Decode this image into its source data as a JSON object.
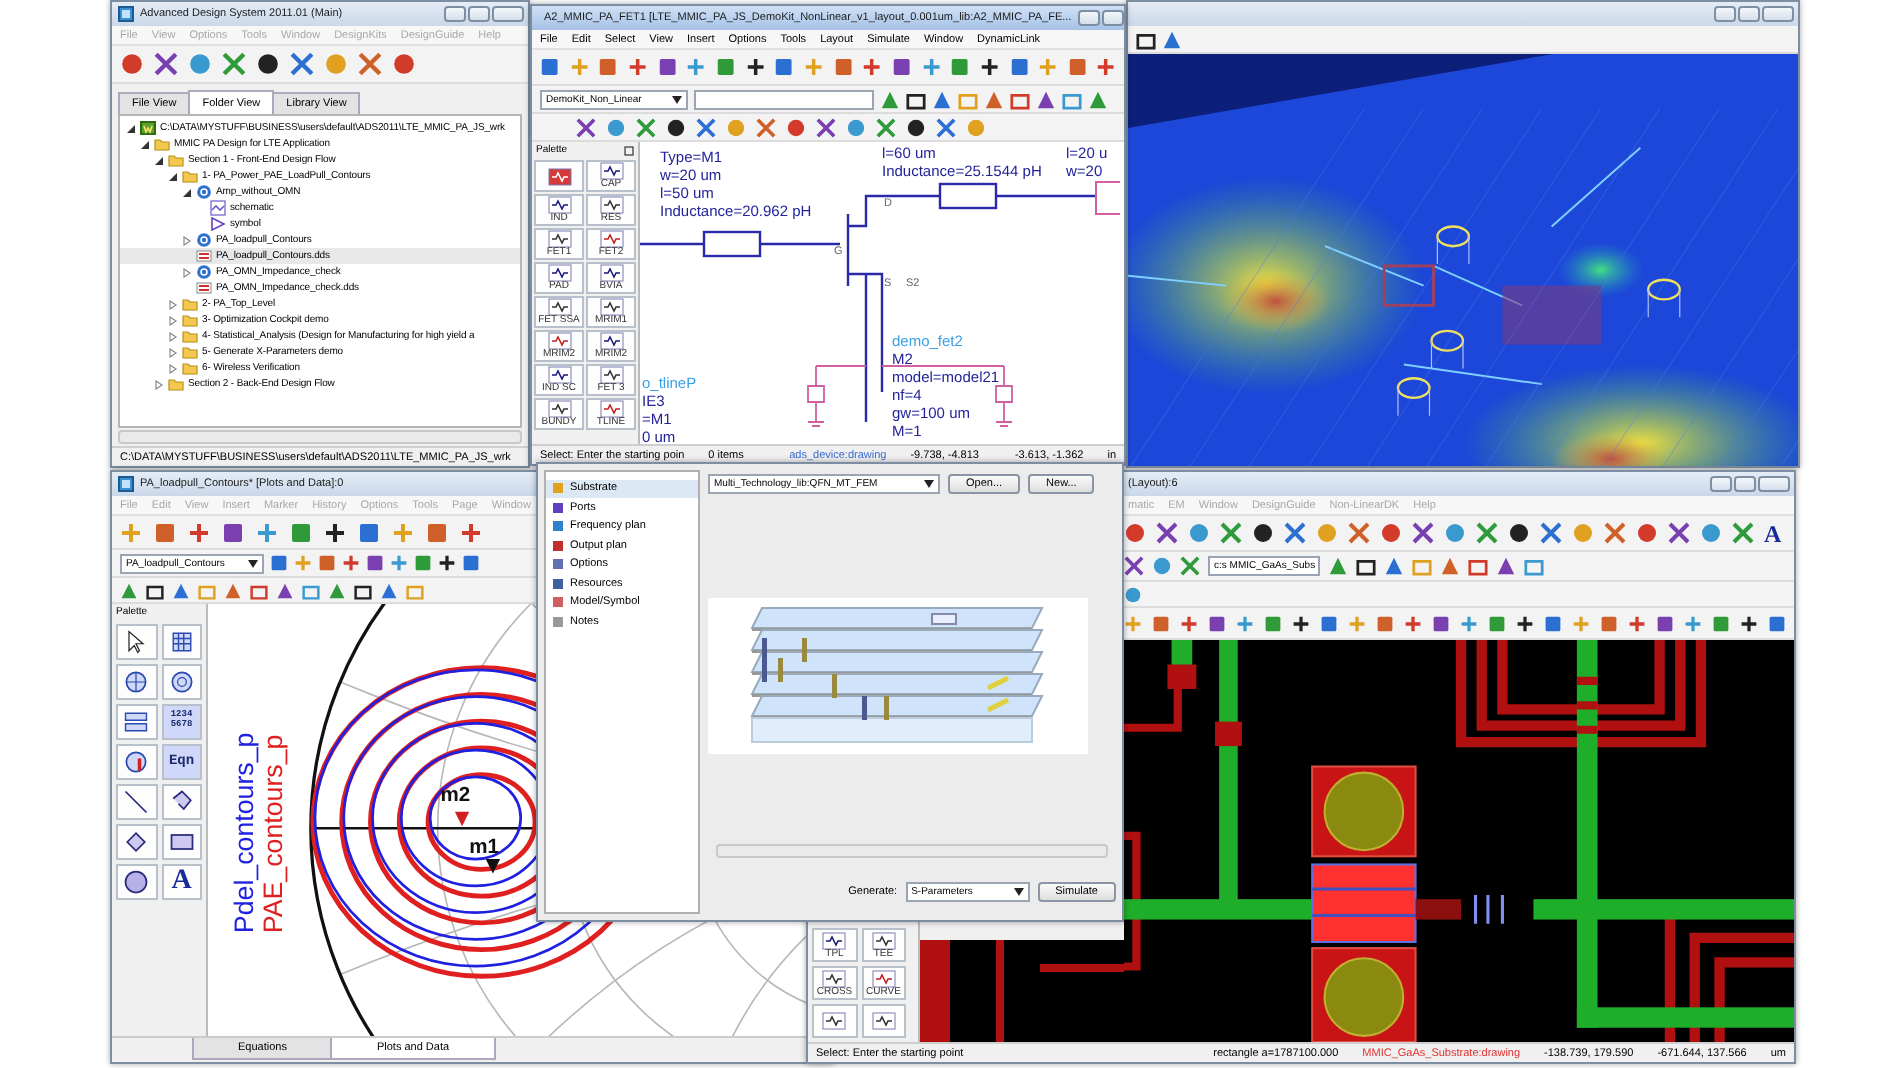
{
  "main_window": {
    "title": "Advanced Design System 2011.01 (Main)",
    "active": false,
    "menu": [
      "File",
      "View",
      "Options",
      "Tools",
      "Window",
      "DesignKits",
      "DesignGuide",
      "Help"
    ],
    "tabs": [
      {
        "label": "File View",
        "selected": false
      },
      {
        "label": "Folder View",
        "selected": true
      },
      {
        "label": "Library View",
        "selected": false
      }
    ],
    "tree": [
      {
        "kind": "workspace",
        "label": "C:\\DATA\\MYSTUFF\\BUSINESS\\users\\default\\ADS2011\\LTE_MMIC_PA_JS_wrk",
        "expanded": true,
        "selected": false,
        "children": [
          {
            "kind": "folder",
            "label": "MMIC PA Design for LTE Application",
            "expanded": true,
            "selected": false,
            "children": [
              {
                "kind": "folder",
                "label": "Section 1 - Front-End Design Flow",
                "expanded": true,
                "selected": false,
                "children": [
                  {
                    "kind": "folder",
                    "label": "1- PA_Power_PAE_LoadPull_Contours",
                    "expanded": true,
                    "selected": false,
                    "children": [
                      {
                        "kind": "cell",
                        "label": "Amp_without_OMN",
                        "expanded": true,
                        "selected": false,
                        "children": [
                          {
                            "kind": "schematic",
                            "label": "schematic",
                            "selected": false
                          },
                          {
                            "kind": "symbol",
                            "label": "symbol",
                            "selected": false
                          }
                        ]
                      },
                      {
                        "kind": "cell",
                        "label": "PA_loadpull_Contours",
                        "expanded": false,
                        "selected": false
                      },
                      {
                        "kind": "dataset",
                        "label": "PA_loadpull_Contours.dds",
                        "selected": true
                      },
                      {
                        "kind": "cell",
                        "label": "PA_OMN_Impedance_check",
                        "expanded": false,
                        "selected": false
                      },
                      {
                        "kind": "dataset",
                        "label": "PA_OMN_Impedance_check.dds",
                        "selected": false
                      }
                    ]
                  },
                  {
                    "kind": "folder",
                    "label": "2- PA_Top_Level",
                    "expanded": false,
                    "selected": false
                  },
                  {
                    "kind": "folder",
                    "label": "3- Optimization Cockpit demo",
                    "expanded": false,
                    "selected": false
                  },
                  {
                    "kind": "folder",
                    "label": "4- Statistical_Analysis (Design for Manufacturing for high yield a",
                    "expanded": false,
                    "selected": false
                  },
                  {
                    "kind": "folder",
                    "label": "5- Generate X-Parameters demo",
                    "expanded": false,
                    "selected": false
                  },
                  {
                    "kind": "folder",
                    "label": "6- Wireless Verification",
                    "expanded": false,
                    "selected": false
                  }
                ]
              },
              {
                "kind": "folder",
                "label": "Section 2 - Back-End Design Flow",
                "expanded": false,
                "selected": false
              }
            ]
          }
        ]
      }
    ],
    "status": "C:\\DATA\\MYSTUFF\\BUSINESS\\users\\default\\ADS2011\\LTE_MMIC_PA_JS_wrk"
  },
  "schematic_window": {
    "title": "A2_MMIC_PA_FET1 [LTE_MMIC_PA_JS_DemoKit_NonLinear_v1_layout_0.001um_lib:A2_MMIC_PA_FE...",
    "active": true,
    "menu": [
      "File",
      "Edit",
      "Select",
      "View",
      "Insert",
      "Options",
      "Tools",
      "Layout",
      "Simulate",
      "Window",
      "DynamicLink"
    ],
    "library_dropdown": "DemoKit_Non_Linear",
    "palette_title": "Palette",
    "palette": [
      "CAP",
      "IND",
      "RES",
      "FET1",
      "FET2",
      "PAD",
      "BVIA",
      "FET SSA",
      "MRIM1",
      "MRIM2",
      "MRIM2",
      "IND SC",
      "FET 3",
      "BUNDY",
      "TLINE"
    ],
    "annotations": [
      {
        "params": [
          "Type=M1",
          "w=20 um",
          "l=50 um",
          "Inductance=20.962 pH"
        ]
      },
      {
        "params": [
          "l=60 um",
          "Inductance=25.1544 pH"
        ]
      },
      {
        "params": [
          "l=20 u",
          "w=20"
        ]
      },
      {
        "name": "o_tlineP",
        "params": [
          "IE3",
          "=M1",
          "0 um"
        ]
      },
      {
        "name": "demo_fet2",
        "params": [
          "M2",
          "model=model21",
          "nf=4",
          "gw=100 um",
          "M=1"
        ]
      }
    ],
    "pins": [
      "D",
      "G",
      "S",
      "S2"
    ],
    "status": [
      "Select: Enter the starting poin",
      "0 items",
      "ads_device:drawing",
      "-9.738, -4.813",
      "-3.613, -1.362",
      "in"
    ]
  },
  "plot_window": {
    "title": "PA_loadpull_Contours* [Plots and Data]:0",
    "active": false,
    "menu": [
      "File",
      "Edit",
      "View",
      "Insert",
      "Marker",
      "History",
      "Options",
      "Tools",
      "Page",
      "Window"
    ],
    "dataset_dropdown": "PA_loadpull_Contours",
    "palette_title": "Palette",
    "palette": [
      {
        "kind": "pointer"
      },
      {
        "kind": "rectangular_plot"
      },
      {
        "kind": "smith_chart"
      },
      {
        "kind": "polar_plot"
      },
      {
        "kind": "stack_plot"
      },
      {
        "kind": "list",
        "lines": [
          "1234",
          "5678"
        ]
      },
      {
        "kind": "antenna_plot"
      },
      {
        "kind": "equation",
        "label": "Eqn"
      },
      {
        "kind": "line"
      },
      {
        "kind": "polyline"
      },
      {
        "kind": "polygon"
      },
      {
        "kind": "rectangle"
      },
      {
        "kind": "circle"
      },
      {
        "kind": "text",
        "label": "A"
      }
    ],
    "legend": [
      {
        "label": "Pdel_contours_p",
        "color": "#2020e0"
      },
      {
        "label": "PAE_contours_p",
        "color": "#e02020"
      }
    ],
    "markers": [
      "m2",
      "m1"
    ],
    "tabs": [
      {
        "label": "Equations",
        "selected": false
      },
      {
        "label": "Plots and Data",
        "selected": true
      }
    ]
  },
  "layout_window": {
    "title": "(Layout):6",
    "active": false,
    "menu": [
      "matic",
      "EM",
      "Window",
      "DesignGuide",
      "Non-LinearDK",
      "Help"
    ],
    "text_tool": "A",
    "substrate_dropdown": "c:s MMIC_GaAs_Subs",
    "palette": [
      "TPL",
      "TEE",
      "CROSS",
      "CURVE"
    ],
    "status": [
      "Select: Enter the starting point",
      "rectangle a=1787100.000",
      "MMIC_GaAs_Substrate:drawing",
      "-138.739, 179.590",
      "-671.644, 137.566",
      "um"
    ]
  },
  "em_dialog": {
    "nav": [
      {
        "label": "Substrate",
        "selected": true
      },
      {
        "label": "Ports",
        "selected": false
      },
      {
        "label": "Frequency plan",
        "selected": false
      },
      {
        "label": "Output plan",
        "selected": false
      },
      {
        "label": "Options",
        "selected": false
      },
      {
        "label": "Resources",
        "selected": false
      },
      {
        "label": "Model/Symbol",
        "selected": false
      },
      {
        "label": "Notes",
        "selected": false
      }
    ],
    "substrate_dropdown": "Multi_Technology_lib:QFN_MT_FEM",
    "buttons": [
      "Open...",
      "New..."
    ],
    "generate_label": "Generate:",
    "generate_dropdown": "S-Parameters",
    "simulate_button": "Simulate"
  }
}
